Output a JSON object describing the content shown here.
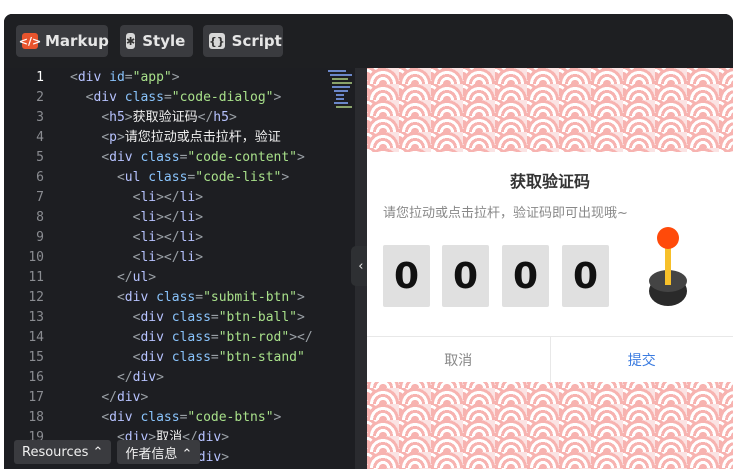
{
  "toolbar": {
    "tabs": [
      {
        "label": "Markup",
        "icon": "markup-icon"
      },
      {
        "label": "Style",
        "icon": "asterisk-icon"
      },
      {
        "label": "Script",
        "icon": "braces-icon"
      }
    ]
  },
  "editor": {
    "line_numbers": [
      "1",
      "2",
      "3",
      "4",
      "5",
      "6",
      "7",
      "8",
      "9",
      "10",
      "11",
      "12",
      "13",
      "14",
      "15",
      "16",
      "17",
      "18",
      "19",
      "20"
    ],
    "active_line": "1",
    "lines": [
      {
        "indent": "",
        "parts": [
          [
            "p",
            "<"
          ],
          [
            "t",
            "div"
          ],
          [
            "a",
            " id"
          ],
          [
            "p",
            "="
          ],
          [
            "s",
            "\"app\""
          ],
          [
            "p",
            ">"
          ]
        ]
      },
      {
        "indent": "  ",
        "parts": [
          [
            "p",
            "<"
          ],
          [
            "t",
            "div"
          ],
          [
            "a",
            " class"
          ],
          [
            "p",
            "="
          ],
          [
            "s",
            "\"code-dialog\""
          ],
          [
            "p",
            ">"
          ]
        ]
      },
      {
        "indent": "    ",
        "parts": [
          [
            "p",
            "<"
          ],
          [
            "t",
            "h5"
          ],
          [
            "p",
            ">"
          ],
          [
            "txt",
            "获取验证码"
          ],
          [
            "p",
            "</"
          ],
          [
            "t",
            "h5"
          ],
          [
            "p",
            ">"
          ]
        ]
      },
      {
        "indent": "    ",
        "parts": [
          [
            "p",
            "<"
          ],
          [
            "t",
            "p"
          ],
          [
            "p",
            ">"
          ],
          [
            "txt",
            "请您拉动或点击拉杆，验证"
          ]
        ]
      },
      {
        "indent": "    ",
        "parts": [
          [
            "p",
            "<"
          ],
          [
            "t",
            "div"
          ],
          [
            "a",
            " class"
          ],
          [
            "p",
            "="
          ],
          [
            "s",
            "\"code-content\""
          ],
          [
            "p",
            ">"
          ]
        ]
      },
      {
        "indent": "      ",
        "parts": [
          [
            "p",
            "<"
          ],
          [
            "t",
            "ul"
          ],
          [
            "a",
            " class"
          ],
          [
            "p",
            "="
          ],
          [
            "s",
            "\"code-list\""
          ],
          [
            "p",
            ">"
          ]
        ]
      },
      {
        "indent": "        ",
        "parts": [
          [
            "p",
            "<"
          ],
          [
            "t",
            "li"
          ],
          [
            "p",
            "></"
          ],
          [
            "t",
            "li"
          ],
          [
            "p",
            ">"
          ]
        ]
      },
      {
        "indent": "        ",
        "parts": [
          [
            "p",
            "<"
          ],
          [
            "t",
            "li"
          ],
          [
            "p",
            "></"
          ],
          [
            "t",
            "li"
          ],
          [
            "p",
            ">"
          ]
        ]
      },
      {
        "indent": "        ",
        "parts": [
          [
            "p",
            "<"
          ],
          [
            "t",
            "li"
          ],
          [
            "p",
            "></"
          ],
          [
            "t",
            "li"
          ],
          [
            "p",
            ">"
          ]
        ]
      },
      {
        "indent": "        ",
        "parts": [
          [
            "p",
            "<"
          ],
          [
            "t",
            "li"
          ],
          [
            "p",
            "></"
          ],
          [
            "t",
            "li"
          ],
          [
            "p",
            ">"
          ]
        ]
      },
      {
        "indent": "      ",
        "parts": [
          [
            "p",
            "</"
          ],
          [
            "t",
            "ul"
          ],
          [
            "p",
            ">"
          ]
        ]
      },
      {
        "indent": "      ",
        "parts": [
          [
            "p",
            "<"
          ],
          [
            "t",
            "div"
          ],
          [
            "a",
            " class"
          ],
          [
            "p",
            "="
          ],
          [
            "s",
            "\"submit-btn\""
          ],
          [
            "p",
            ">"
          ]
        ]
      },
      {
        "indent": "        ",
        "parts": [
          [
            "p",
            "<"
          ],
          [
            "t",
            "div"
          ],
          [
            "a",
            " class"
          ],
          [
            "p",
            "="
          ],
          [
            "s",
            "\"btn-ball\""
          ],
          [
            "p",
            ">"
          ]
        ]
      },
      {
        "indent": "        ",
        "parts": [
          [
            "p",
            "<"
          ],
          [
            "t",
            "div"
          ],
          [
            "a",
            " class"
          ],
          [
            "p",
            "="
          ],
          [
            "s",
            "\"btn-rod\""
          ],
          [
            "p",
            "></"
          ]
        ]
      },
      {
        "indent": "        ",
        "parts": [
          [
            "p",
            "<"
          ],
          [
            "t",
            "div"
          ],
          [
            "a",
            " class"
          ],
          [
            "p",
            "="
          ],
          [
            "s",
            "\"btn-stand\""
          ]
        ]
      },
      {
        "indent": "      ",
        "parts": [
          [
            "p",
            "</"
          ],
          [
            "t",
            "div"
          ],
          [
            "p",
            ">"
          ]
        ]
      },
      {
        "indent": "    ",
        "parts": [
          [
            "p",
            "</"
          ],
          [
            "t",
            "div"
          ],
          [
            "p",
            ">"
          ]
        ]
      },
      {
        "indent": "    ",
        "parts": [
          [
            "p",
            "<"
          ],
          [
            "t",
            "div"
          ],
          [
            "a",
            " class"
          ],
          [
            "p",
            "="
          ],
          [
            "s",
            "\"code-btns\""
          ],
          [
            "p",
            ">"
          ]
        ]
      },
      {
        "indent": "      ",
        "parts": [
          [
            "p",
            "<"
          ],
          [
            "t",
            "div"
          ],
          [
            "p",
            ">"
          ],
          [
            "txt",
            "取消"
          ],
          [
            "p",
            "</"
          ],
          [
            "t",
            "div"
          ],
          [
            "p",
            ">"
          ]
        ]
      },
      {
        "indent": "      ",
        "parts": [
          [
            "p",
            "<"
          ],
          [
            "t",
            "div"
          ],
          [
            "p",
            ">"
          ],
          [
            "txt",
            "提交"
          ],
          [
            "p",
            "</"
          ],
          [
            "t",
            "div"
          ],
          [
            "p",
            ">"
          ]
        ]
      }
    ]
  },
  "preview": {
    "title": "获取验证码",
    "description": "请您拉动或点击拉杆，验证码即可出现哦~",
    "digits": [
      "0",
      "0",
      "0",
      "0"
    ],
    "cancel_label": "取消",
    "submit_label": "提交"
  },
  "bottom_bar": {
    "resources_label": "Resources ⌃",
    "author_label": "作者信息 ⌃"
  },
  "colors": {
    "editor_bg": "#1d1e22",
    "accent_orange": "#ff4a0a",
    "lever_rod": "#f7c02a",
    "submit_blue": "#3a7be0"
  }
}
